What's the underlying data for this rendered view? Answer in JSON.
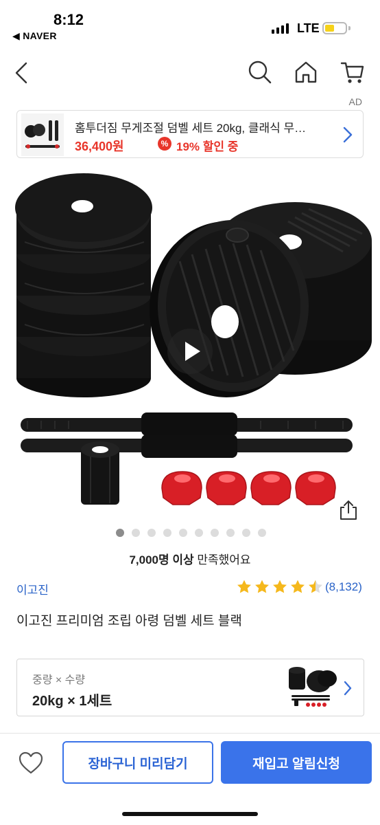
{
  "status_bar": {
    "time": "8:12",
    "back_app": "◀ NAVER",
    "network": "LTE",
    "battery_color": "#f6d21a"
  },
  "nav": {
    "back_icon": "chevron-left-icon",
    "search_icon": "search-icon",
    "home_icon": "home-icon",
    "cart_icon": "shopping-cart-icon"
  },
  "ad": {
    "label": "AD",
    "title": "홈투더짐 무게조절 덤벨 세트 20kg, 클래식 무…",
    "price": "36,400원",
    "discount_badge": "%",
    "discount_text": "19% 할인 중",
    "accent_color": "#e8352a"
  },
  "media": {
    "play_icon": "play-icon",
    "share_icon": "share-icon",
    "total_images": 10,
    "active_index": 0
  },
  "satisfaction": {
    "count": "7,000명 이상",
    "text": " 만족했어요"
  },
  "product": {
    "brand": "이고진",
    "rating": 4.5,
    "review_count": "(8,132)",
    "name": "이고진 프리미엄 조립 아령 덤벨 세트 블랙"
  },
  "option": {
    "label": "중량 × 수량",
    "value": "20kg × 1세트"
  },
  "bottom": {
    "cart_button": "장바구니 미리담기",
    "alert_button": "재입고 알림신청",
    "primary_color": "#3a73ea"
  }
}
